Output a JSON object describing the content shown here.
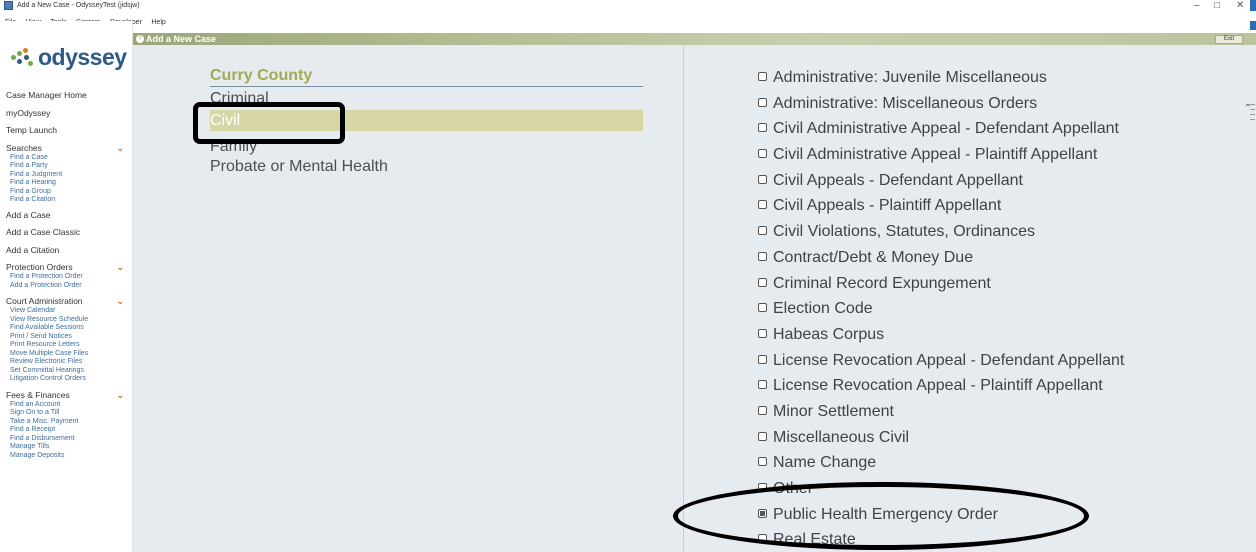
{
  "window": {
    "title": "Add a New Case - OdysseyTest (jidsjw)",
    "minimize": "–",
    "maximize": "□",
    "close": "✕"
  },
  "menu": [
    "File",
    "View",
    "Tools",
    "Centers",
    "Developer",
    "Help"
  ],
  "logo": {
    "text": "odyssey"
  },
  "sidebar": {
    "top_links": [
      "Case Manager Home",
      "myOdyssey",
      "Temp Launch"
    ],
    "searches": {
      "label": "Searches",
      "items": [
        "Find a Case",
        "Find a Party",
        "Find a Judgment",
        "Find a Hearing",
        "Find a Group",
        "Find a Citation"
      ]
    },
    "mid_links": [
      "Add a Case",
      "Add a Case Classic",
      "Add a Citation"
    ],
    "protection_orders": {
      "label": "Protection Orders",
      "items": [
        "Find a Protection Order",
        "Add a Protection Order"
      ]
    },
    "court_administration": {
      "label": "Court Administration",
      "items": [
        "View Calendar",
        "View Resource Schedule",
        "Find Available Sessions",
        "Print / Send Notices",
        "Print Resource Letters",
        "Move Multiple Case Files",
        "Review Electronic Files",
        "Set Committal Hearings",
        "Litigation Control Orders"
      ]
    },
    "fees_finances": {
      "label": "Fees & Finances",
      "items": [
        "Find an Account",
        "Sign On to a Till",
        "Take a Misc. Payment",
        "Find a Receipt",
        "Find a Disbursement",
        "Manage Tills",
        "Manage Deposits"
      ]
    }
  },
  "header": {
    "title": "Add a New Case",
    "exit": "Exit"
  },
  "left_panel": {
    "county": "Curry County",
    "categories": [
      "Criminal",
      "Civil",
      "Family",
      "Probate or Mental Health"
    ],
    "selected": "Civil"
  },
  "case_types": [
    "Administrative: Juvenile Miscellaneous",
    "Administrative: Miscellaneous Orders",
    "Civil Administrative Appeal - Defendant Appellant",
    "Civil Administrative Appeal - Plaintiff Appellant",
    "Civil Appeals - Defendant Appellant",
    "Civil Appeals - Plaintiff Appellant",
    "Civil Violations, Statutes, Ordinances",
    "Contract/Debt & Money Due",
    "Criminal Record Expungement",
    "Election Code",
    "Habeas Corpus",
    "License Revocation Appeal - Defendant Appellant",
    "License Revocation Appeal - Plaintiff Appellant",
    "Minor Settlement",
    "Miscellaneous Civil",
    "Name Change",
    "Other",
    "Public Health Emergency Order",
    "Real Estate"
  ],
  "selected_case_type": "Public Health Emergency Order",
  "colors": {
    "accent_green": "#a2aa52",
    "selected_row": "#d6d6a6",
    "panel_bg": "#e6ebf0",
    "link_blue": "#3f6e9e",
    "chevron_orange": "#e07a1c"
  }
}
